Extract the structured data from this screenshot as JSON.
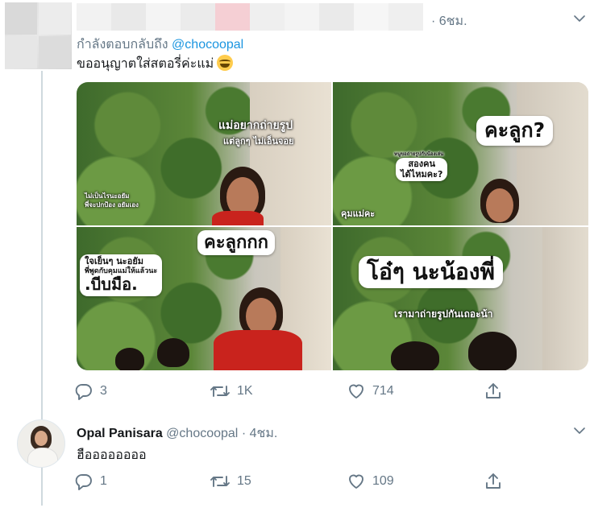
{
  "tweet1": {
    "time": "· 6ชม.",
    "reply_prefix": "กำลังตอบกลับถึง ",
    "reply_handle": "@chocoopal",
    "text": "ขออนุญาตใส่สตอรี่ค่ะแม่",
    "emoji": "face-with-tears-of-joy-icon",
    "images": {
      "p1": {
        "cap_top_1": "แม่อยากถ่ายรูป",
        "cap_top_2": "แต่ลูกๆ ไม่เอ็นจอย",
        "cap_left_1": "ไม่เป็นไรนะอยัม",
        "cap_left_2": "พี่จะปกป้อง อยัมเอง"
      },
      "p2": {
        "cap_big": "คะลูก?",
        "cap_small": "หนูขอถ่ายรูปกับน้องเล่น",
        "cap_mid_1": "สองคน",
        "cap_mid_2": "ได้ไหมคะ?",
        "cap_bottom": "คุมแม่คะ"
      },
      "p3": {
        "cap_top": "คะลูกกก",
        "cap_left_1": "ใจเย็นๆ นะอยัม",
        "cap_left_2": "พี่พูดกับคุมแม่ให้แล้วนะ",
        "cap_left_3": ".บีบมือ."
      },
      "p4": {
        "cap_big": "โอ๋ๆ นะน้องพี่",
        "cap_sub": "เรามาถ่ายรูปกันเถอะน้า"
      }
    },
    "actions": {
      "replies": "3",
      "retweets": "1K",
      "likes": "714"
    }
  },
  "tweet2": {
    "display_name": "Opal Panisara",
    "handle": "@chocoopal",
    "time": "· 4ชม.",
    "text": "ฮืออออออออ",
    "actions": {
      "replies": "1",
      "retweets": "15",
      "likes": "109"
    }
  },
  "colors": {
    "link": "#1b95e0",
    "muted": "#657786",
    "thread_line": "#cfd9de"
  }
}
